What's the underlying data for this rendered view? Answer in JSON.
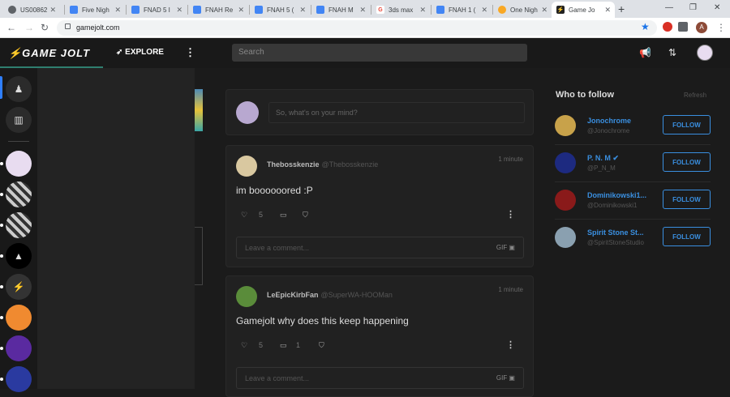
{
  "browser": {
    "tabs": [
      {
        "title": "US00862",
        "icon": "globe-icon",
        "color": "#5f6368"
      },
      {
        "title": "Five Nigh",
        "icon": "doc-icon",
        "color": "#4285f4"
      },
      {
        "title": "FNAD 5 I",
        "icon": "doc-icon",
        "color": "#4285f4"
      },
      {
        "title": "FNAH Re",
        "icon": "doc-icon",
        "color": "#4285f4"
      },
      {
        "title": "FNAH 5 (",
        "icon": "doc-icon",
        "color": "#4285f4"
      },
      {
        "title": "FNAH M",
        "icon": "doc-icon",
        "color": "#4285f4"
      },
      {
        "title": "3ds max",
        "icon": "google-icon",
        "color": "#ea4335"
      },
      {
        "title": "FNAH 1 (",
        "icon": "doc-icon",
        "color": "#4285f4"
      },
      {
        "title": "One Nigh",
        "icon": "coin-icon",
        "color": "#f9a825"
      },
      {
        "title": "Game Jo",
        "icon": "gamejolt-icon",
        "color": "#2f7f6f"
      }
    ],
    "active_tab": 9,
    "new_tab": "+",
    "url": "gamejolt.com",
    "profile_initial": "A",
    "window_controls": [
      "—",
      "❐",
      "✕"
    ]
  },
  "header": {
    "logo": "⚡GAME JOLT",
    "explore_label": "EXPLORE",
    "search_placeholder": "Search"
  },
  "compose": {
    "placeholder": "So, what's on your mind?"
  },
  "posts": [
    {
      "author": "Thebosskenzie",
      "handle": "@Thebosskenzie",
      "time": "1 minute",
      "body": "im boooooored :P",
      "likes": "5",
      "comments": "",
      "comment_placeholder": "Leave a comment...",
      "avatar_color": "#d9c8a0"
    },
    {
      "author": "LeEpicKirbFan",
      "handle": "@SuperWA-HOOMan",
      "time": "1 minute",
      "body": "Gamejolt why does this keep happening",
      "likes": "5",
      "comments": "1",
      "comment_placeholder": "Leave a comment...",
      "avatar_color": "#5a8c3a"
    }
  ],
  "who_to_follow": {
    "title": "Who to follow",
    "refresh": "Refresh",
    "follow_label": "FOLLOW",
    "users": [
      {
        "name": "Jonochrome",
        "handle": "@Jonochrome",
        "color": "#c8a24a",
        "verified": false
      },
      {
        "name": "P. N. M",
        "handle": "@P_N_M",
        "color": "#1d2a80",
        "verified": true
      },
      {
        "name": "Dominikowski1...",
        "handle": "@Dominikowski1",
        "color": "#8a1a1a",
        "verified": false
      },
      {
        "name": "Spirit Stone St...",
        "handle": "@SpiritStoneStudio",
        "color": "#8aa0b0",
        "verified": false
      }
    ]
  }
}
